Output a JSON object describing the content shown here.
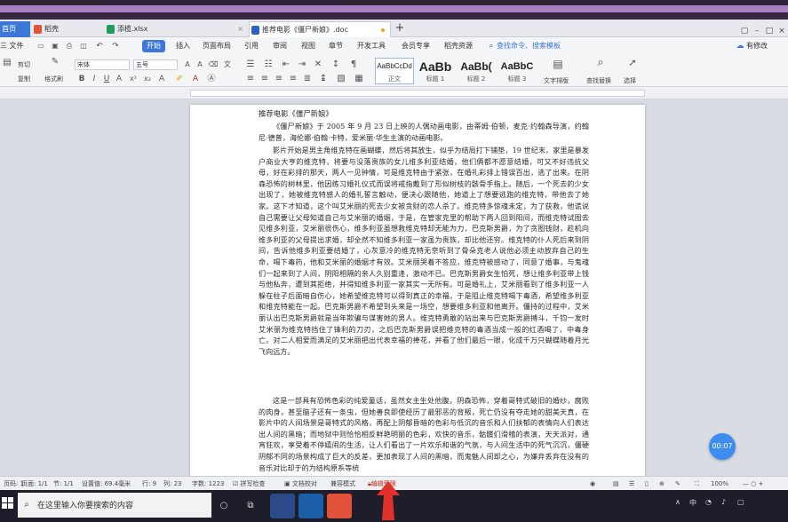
{
  "colors": {
    "accent": "#3d78d8",
    "wps_red": "#e2513a",
    "excel_green": "#1e9e5a",
    "word_blue": "#2b63c5",
    "arrow_red": "#e2312a",
    "timer_blue": "#3d8df0"
  },
  "tabs": [
    {
      "label": "首页",
      "icon": "home-icon"
    },
    {
      "label": "稻壳",
      "icon": "docer-icon"
    },
    {
      "label": "添榄.xlsx",
      "icon": "excel-icon"
    },
    {
      "label": "推荐电影《僵尸新娘》.doc",
      "icon": "word-icon",
      "active": true
    }
  ],
  "menu": {
    "file": "三 文件",
    "items": [
      "开始",
      "插入",
      "页面布局",
      "引用",
      "审阅",
      "视图",
      "章节",
      "开发工具",
      "会员专享",
      "稻壳资源"
    ],
    "search": "查找命令、搜索模板",
    "has_changes": "有修改"
  },
  "ribbon": {
    "cut": "剪切",
    "copy": "复制",
    "format_painter": "格式刷",
    "font": "宋体",
    "size": "五号",
    "styles": [
      {
        "preview": "AaBbCcDd",
        "label": "正文"
      },
      {
        "preview": "AaBb",
        "label": "标题 1"
      },
      {
        "preview": "AaBb(",
        "label": "标题 2"
      },
      {
        "preview": "AaBbC",
        "label": "标题 3"
      }
    ],
    "text_layout": "文字排版",
    "find_replace": "查找替换",
    "select": "选择"
  },
  "document": {
    "title": "推荐电影《僵尸新娘》",
    "paragraphs": [
      "《僵尸新娘》于 2005 年 9 月 23 日上映的人偶动画电影，由蒂姆·伯顿，麦克·约翰森导演，约翰尼·德普，海伦娜·伯翰·卡特，爱米丽·华生主演的动画电影。",
      "影片开始是男主角维克特在画蝴蝶，然后将其放生，似乎为结局打下铺垫，19 世纪末，家里是暴发户商业大亨的维克特，将要与没落贵族的女儿维多利亚结婚，他们俩都不愿意结婚，可又不好违抗父母，好在彩排的那天，两人一见钟情，可是维克特由于紧张，在婚礼彩排上错误百出，逃了出来。在阴森恐怖的树林里，他因练习婚礼仪式而误将戒指戴到了形似树枝的骸骨手指上。随后，一个死去的少女出现了，她被维克特感人的婚礼誓言触动，便决心跟随他，她道上了想要逃跑的维克特，带他去了她家。这下才知道，这个叫艾米丽的死去少女被贪财的恋人杀了。维克特多惊魂未定，为了获救，他谎说自己需要让父母知道自己与艾米丽的婚姻，于是，在管家克里的帮助下两人回到阳间，而维克特试图去见维多利亚，艾米丽很伤心，维多利亚虽想救维克特却无能为力，巴克斯男爵，为了贪图钱财，趁机向维多利亚的父母提出求婚，却全然不知维多利亚一家虽为贵族，却比他还穷。维克特的仆人死后来到阴间，告诉他维多利亚要结婚了，心灰意冷的维克特无奈听到了骨朵克老人说他必须主动放弃自己的生命，喝下毒药，他和艾米丽的婚姻才有效。艾米丽哭着不答应，维克特被感动了，同意了婚事，与鬼魂们一起来到了人间，阴阳相隔的亲人久别重逢，激动不已。巴克斯男爵女生怕死，想让维多利亚带上钱与他私奔，遭到其拒绝，并得知维多利亚一家其实一无所有。可是婚礼上，艾米丽看到了维多利亚一人躲在柱子后面暗自伤心，她希望维克特可以得到真正的幸福，于是阻止维克特喝下毒酒，希望维多利亚和维克特能在一起。巴克斯男爵不希望到头来是一场空，想要维多利亚和他离开。僵持的过程中，艾米丽认出巴克斯男爵就是当年欺骗与谋害她的男人。维克特勇敢的站出来与巴克斯男爵搏斗，千钧一发时艾米丽为维克特挡住了锋利的刀刃，之后巴克斯男爵误把维克特的毒酒当成一般的红酒喝了，中毒身亡。对二人相爱而满足的艾米丽把出代表幸福的捧花，并看了他们最后一眼，化成千万只蝴蝶随着月光飞向远方。",
      "这是一部具有恐怖色彩的纯爱童话，虽然女主生处他腹，阴森恐怖，穿着哥特式破旧的婚纱，腐败的肉身，甚至脑子还有一条虫，但她善良即使经历了最邪恶的背叛，死亡仍没有夺走她的甜美天真，在影片中的人间场景是哥特式的风格，再配上阴郁昏暗的色彩与低沉的音乐和人们扶郁的表情向人们表达出人间的黑暗；而地狱中则恰恰相反鲜艳明丽的色彩，欢快的音乐，骷髅们滑稽的表演，天天派对，通宵狂欢，享受着不停嬉闹的生活，让人们看出了一片欢乐和谐的气氛，与人间生活中的死气沉沉，僵硬阴郁不同的场景构成了巨大的反差，更加表现了人间的黑暗，而鬼魅人间却之心，为嫌弃丢弃在没有的音乐对比却于的为结构原系等统"
    ]
  },
  "timer": "00:07",
  "status": {
    "page": "页码: 1",
    "pages": "页面: 1/1",
    "section": "节: 1/1",
    "position": "设置值: 69.4毫米",
    "row": "行: 9",
    "col": "列: 23",
    "words": "字数: 1223",
    "spell": "拼写检查",
    "doc_check": "文档校对",
    "compat": "兼容模式",
    "protect": "编辑受限",
    "zoom": "100%"
  },
  "taskbar": {
    "search_placeholder": "在这里输入你要搜索的内容",
    "ime": "中"
  }
}
